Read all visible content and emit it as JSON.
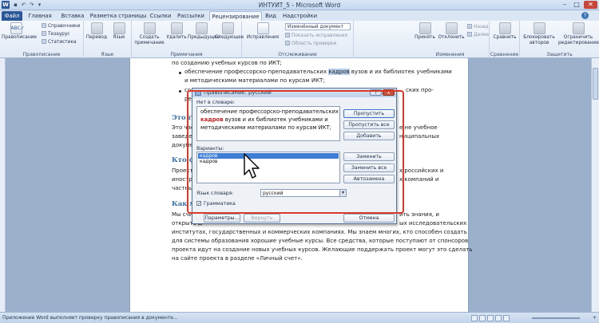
{
  "window": {
    "title": "ИНТУИТ_5 - Microsoft Word",
    "app_letter": "W"
  },
  "tabs": [
    "Файл",
    "Главная",
    "Вставка",
    "Разметка страницы",
    "Ссылки",
    "Рассылки",
    "Рецензирование",
    "Вид",
    "Надстройки"
  ],
  "ribbon": {
    "spelling": {
      "big": "Правописание",
      "items": [
        "Справочники",
        "Тезаурус",
        "Статистика"
      ],
      "group": "Правописание"
    },
    "language": {
      "translate": "Перевод",
      "lang": "Язык",
      "group": "Язык"
    },
    "comments": {
      "create": "Создать примечание",
      "delete": "Удалить",
      "prev": "Предыдущее",
      "next": "Следующее",
      "group": "Примечания"
    },
    "tracking": {
      "fixes": "Исправления",
      "dropdown": "Изменённый документ",
      "show": "Показать исправления",
      "area": "Область проверки",
      "group": "Отслеживание"
    },
    "changes": {
      "accept": "Принять",
      "reject": "Отклонить",
      "prev": "Назад",
      "next": "Далее",
      "group": "Изменения"
    },
    "compare": {
      "compare": "Сравнить",
      "group": "Сравнение"
    },
    "protect": {
      "block": "Блокировать авторов",
      "restrict": "Ограничить редактирование",
      "group": "Защитить"
    }
  },
  "document": {
    "line1": "по созданию учебных курсов по ИКТ;",
    "bullet1a": "обеспечение профессорско-преподавательских ",
    "bullet1_hl": "кадров",
    "bullet1b": " вузов и их библиотек учебниками",
    "bullet1c": "и методическими материалами по курсам ИКТ;",
    "bullet2a": "со",
    "bullet2b": "ских про-",
    "bullet2c": "ре",
    "h1": "Это гос",
    "p1a": "Это частн",
    "p1a_r": "е не учебное",
    "p1b": "заведени",
    "p1b_r": "ниципальных",
    "p1c": "докумен",
    "h2": "Кто ф",
    "p2a": "Проект у",
    "p2a_r": "х российских и",
    "p2b": "иностра",
    "p2b_r": "х компаний и",
    "p2c": "частных о",
    "h3": "Как мо",
    "p3a": "Мы счита",
    "p3a_r": "ить знания, и",
    "p3b": "открыто д",
    "p3b_r": "ых исследовательских",
    "p3c": "институтах, государственных и коммерческих компаниях. Мы знаем многих, кто способен создать",
    "p3d": "для системы образования хорошие учебные курсы. Все средства, которые поступают от спонсоров",
    "p3e": "проекта идут на создание новых учебных курсов. Желающие поддержать проект могут это сделать",
    "p3f": "на сайте проекта в разделе «Личный счет»."
  },
  "dialog": {
    "title": "Правописание: русский",
    "notfound_label": "Нет в словаре:",
    "notfound_line1": "обеспечение профессорско-преподавательских",
    "notfound_word": "кадров",
    "notfound_line2b": " вузов и их библиотек учебниками и",
    "notfound_line3": "методическими материалами по курсам ИКТ;",
    "suggestions_label": "Варианты:",
    "suggestions": [
      "кадров",
      "кадров"
    ],
    "lang_label": "Язык словаря:",
    "lang_value": "русский",
    "grammar_label": "Грамматика",
    "buttons": {
      "skip": "Пропустить",
      "skip_all": "Пропустить все",
      "add": "Добавить",
      "replace": "Заменить",
      "replace_all": "Заменить все",
      "autocorrect": "Автозамена",
      "params": "Параметры...",
      "undo": "Вернуть",
      "cancel": "Отмена"
    },
    "help": "?",
    "close": "X"
  },
  "status": {
    "message": "Приложение Word выполняет проверку правописания в документе...",
    "zoom": "+"
  },
  "colors": {
    "frame": "#d93a2a",
    "accent": "#2b5797",
    "heading": "#3a6ea5"
  }
}
